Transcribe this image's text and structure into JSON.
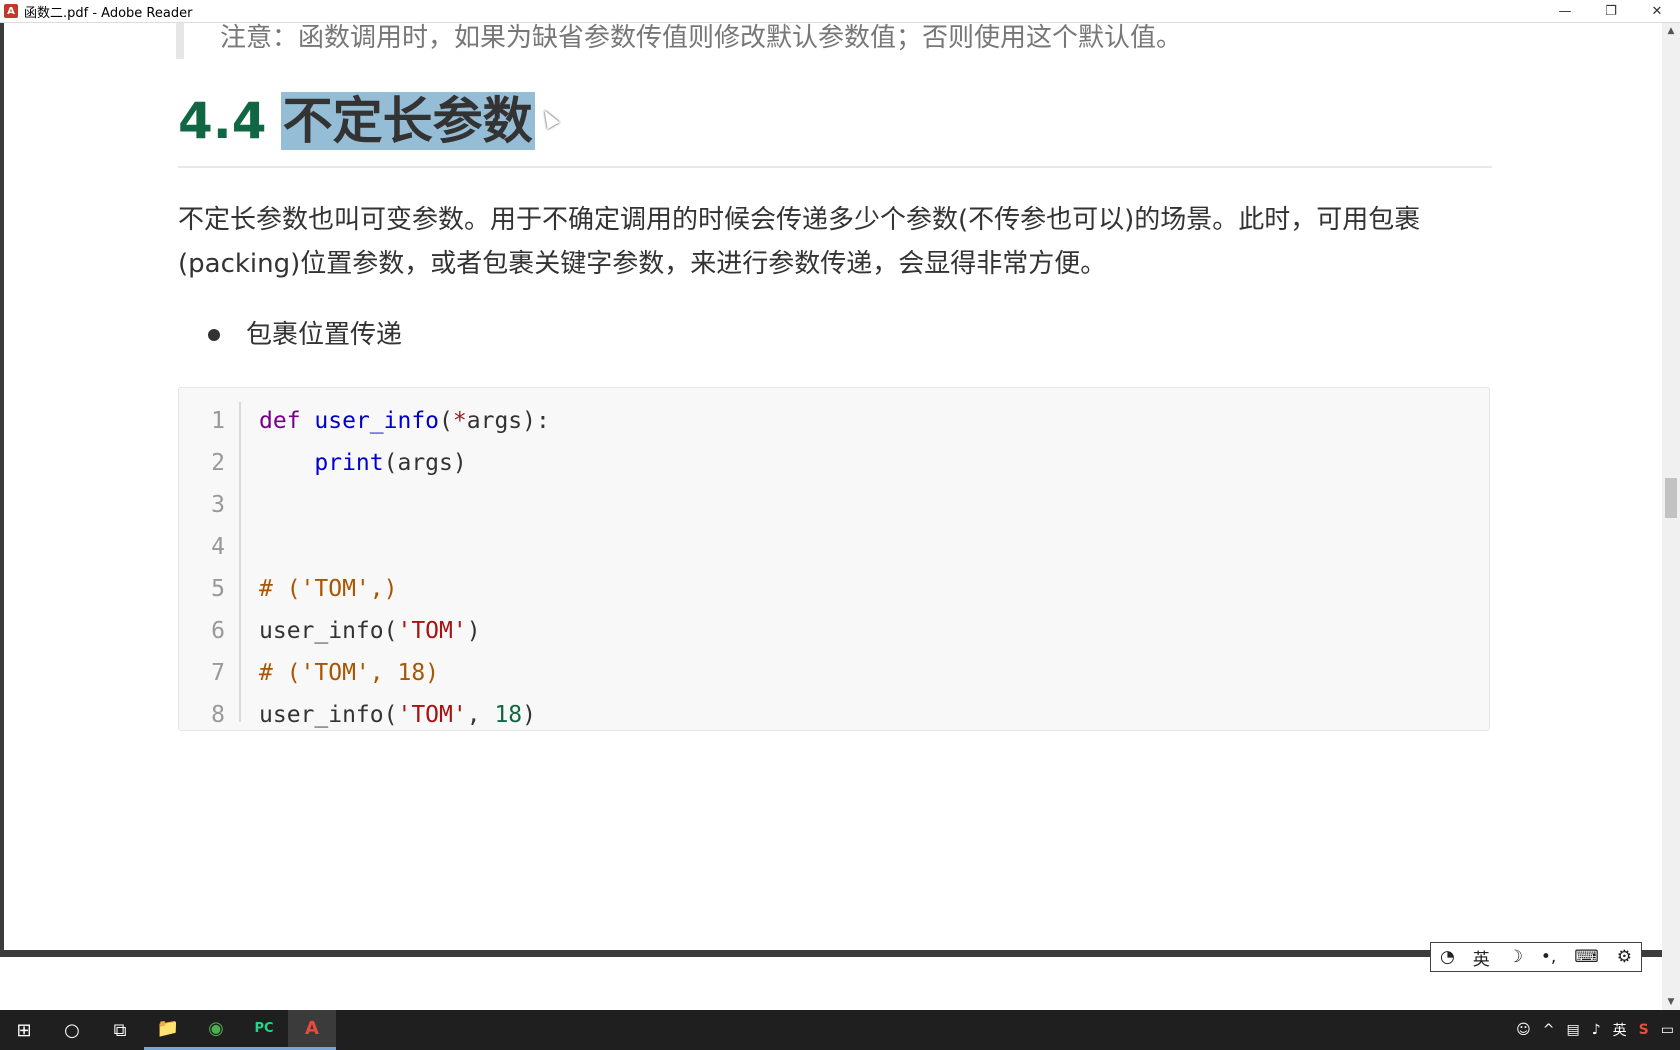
{
  "window": {
    "title": "函数二.pdf - Adobe Reader",
    "minimize": "—",
    "restore": "❐",
    "close": "✕"
  },
  "doc": {
    "quote": "注意：函数调用时，如果为缺省参数传值则修改默认参数值；否则使用这个默认值。",
    "heading_num": "4.4",
    "heading_text": "不定长参数",
    "paragraph": "不定长参数也叫可变参数。用于不确定调用的时候会传递多少个参数(不传参也可以)的场景。此时，可用包裹(packing)位置参数，或者包裹关键字参数，来进行参数传递，会显得非常方便。",
    "bullet": "包裹位置传递"
  },
  "code": {
    "line_numbers": [
      "1",
      "2",
      "3",
      "4",
      "5",
      "6",
      "7",
      "8"
    ],
    "l1_kw": "def",
    "l1_fn": "user_info",
    "l1_rest_a": "(",
    "l1_op": "*",
    "l1_rest_b": "args):",
    "l2_fn": "print",
    "l2_rest": "(args)",
    "l5_cmt": "# ('TOM',)",
    "l6_a": "user_info(",
    "l6_str": "'TOM'",
    "l6_b": ")",
    "l7_cmt": "# ('TOM', 18)",
    "l8_a": "user_info(",
    "l8_str": "'TOM'",
    "l8_b": ", ",
    "l8_num": "18",
    "l8_c": ")"
  },
  "ime": {
    "mode": "英",
    "moon": "☽",
    "punct": "•,",
    "keyboard": "⌨",
    "settings": "⚙"
  },
  "taskbar": {
    "start": "⊞",
    "search": "○",
    "taskview": "⧉",
    "explorer": "📁",
    "chrome": "◉",
    "pycharm": "PC",
    "reader": "A",
    "tray_people": "☺",
    "tray_up": "^",
    "tray_lang": "英",
    "tray_notify": "▭"
  }
}
